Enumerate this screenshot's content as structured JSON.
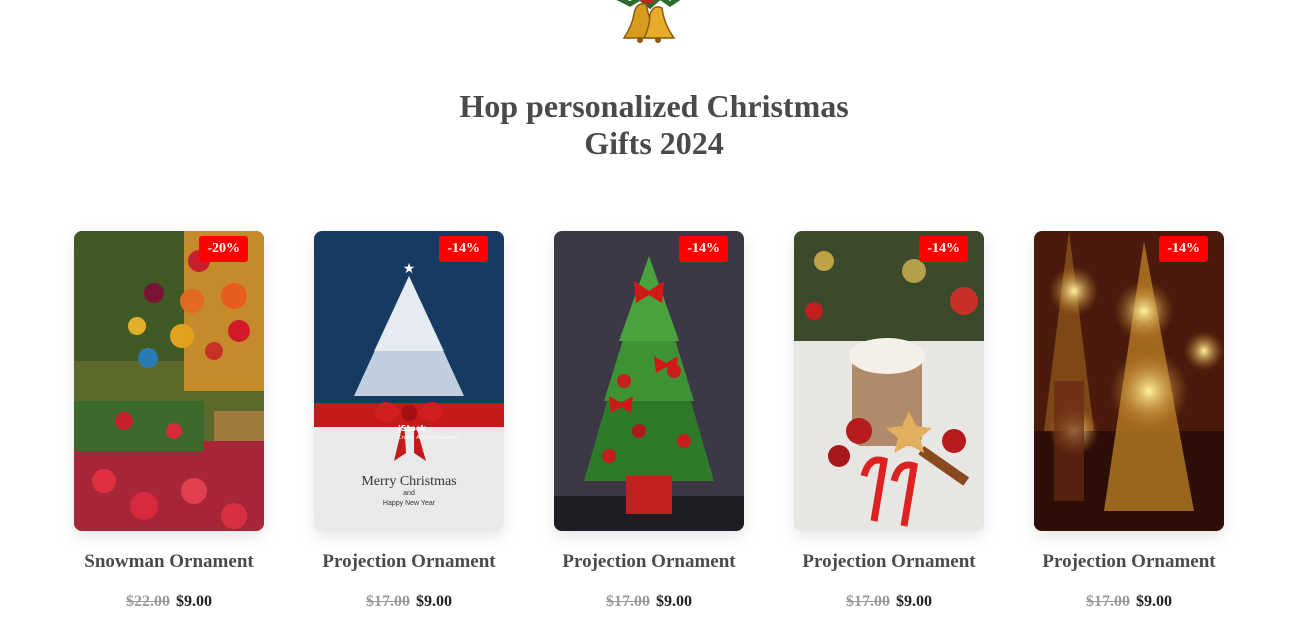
{
  "section": {
    "title_line1": "Hop personalized Christmas",
    "title_line2": "Gifts 2024"
  },
  "products": [
    {
      "name": "Snowman Ornament",
      "badge": "-20%",
      "old_price": "$22.00",
      "price": "$9.00",
      "image": "christmas-market-ornaments"
    },
    {
      "name": "Projection Ornament",
      "badge": "-14%",
      "old_price": "$17.00",
      "price": "$9.00",
      "image": "merry-christmas-card",
      "card_text": {
        "line1": "Merry Christmas",
        "line2": "and",
        "line3": "Happy New Year",
        "watermark": "iStock",
        "credit": "Credit: Achmad Saziyan"
      }
    },
    {
      "name": "Projection Ornament",
      "badge": "-14%",
      "old_price": "$17.00",
      "price": "$9.00",
      "image": "mini-christmas-tree"
    },
    {
      "name": "Projection Ornament",
      "badge": "-14%",
      "old_price": "$17.00",
      "price": "$9.00",
      "image": "christmas-drink-candy-canes"
    },
    {
      "name": "Projection Ornament",
      "badge": "-14%",
      "old_price": "$17.00",
      "price": "$9.00",
      "image": "bokeh-christmas-lights"
    }
  ],
  "colors": {
    "badge": "#ff0000",
    "title": "#4a4a4a",
    "old_price": "#9a9a9a",
    "price": "#222222"
  }
}
